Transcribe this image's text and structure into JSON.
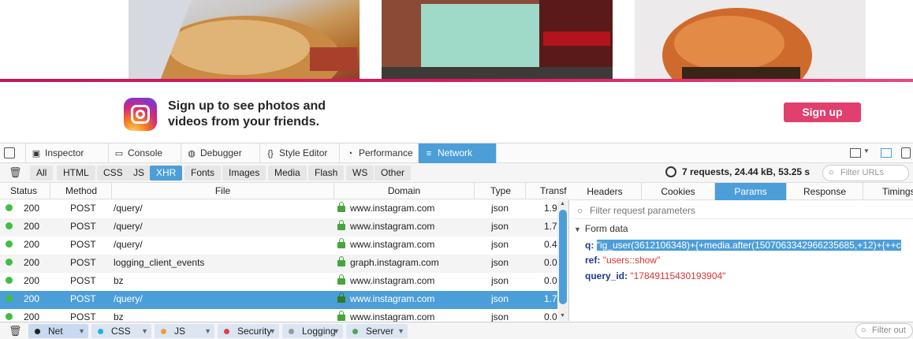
{
  "banner": {
    "text": "Sign up to see photos and videos from your friends.",
    "signup_label": "Sign up",
    "brand_color": "#e13f6e"
  },
  "devtools": {
    "tabs": [
      "Inspector",
      "Console",
      "Debugger",
      "Style Editor",
      "Performance",
      "Network"
    ],
    "active_tab": "Network",
    "filters": [
      "All",
      "HTML",
      "CSS",
      "JS",
      "XHR",
      "Fonts",
      "Images",
      "Media",
      "Flash",
      "WS",
      "Other"
    ],
    "active_filter": "XHR",
    "summary": "7 requests, 24.44 kB, 53.25 s",
    "filter_urls_placeholder": "Filter URLs",
    "columns": [
      "Status",
      "Method",
      "File",
      "Domain",
      "Type",
      "Transf"
    ],
    "requests": [
      {
        "status": "200",
        "method": "POST",
        "file": "/query/",
        "domain": "www.instagram.com",
        "type": "json",
        "transferred": "1.9"
      },
      {
        "status": "200",
        "method": "POST",
        "file": "/query/",
        "domain": "www.instagram.com",
        "type": "json",
        "transferred": "1.7"
      },
      {
        "status": "200",
        "method": "POST",
        "file": "/query/",
        "domain": "www.instagram.com",
        "type": "json",
        "transferred": "0.4"
      },
      {
        "status": "200",
        "method": "POST",
        "file": "logging_client_events",
        "domain": "graph.instagram.com",
        "type": "json",
        "transferred": "0.0"
      },
      {
        "status": "200",
        "method": "POST",
        "file": "bz",
        "domain": "www.instagram.com",
        "type": "json",
        "transferred": "0.0"
      },
      {
        "status": "200",
        "method": "POST",
        "file": "/query/",
        "domain": "www.instagram.com",
        "type": "json",
        "transferred": "1.7"
      },
      {
        "status": "200",
        "method": "POST",
        "file": "bz",
        "domain": "www.instagram.com",
        "type": "json",
        "transferred": "0.0"
      }
    ],
    "selected_row": 5,
    "details": {
      "tabs": [
        "Headers",
        "Cookies",
        "Params",
        "Response",
        "Timings"
      ],
      "active_tab": "Params",
      "filter_placeholder": "Filter request parameters",
      "section": "Form data",
      "params": [
        {
          "key": "q",
          "value": "\"ig_user(3612106348)+{+media.after(1507063342966235685,+12)+{++c"
        },
        {
          "key": "ref",
          "value": "\"users::show\""
        },
        {
          "key": "query_id",
          "value": "\"17849115430193904\""
        }
      ]
    },
    "console_filters": [
      {
        "label": "Net",
        "color": "#222222"
      },
      {
        "label": "CSS",
        "color": "#1eaee9"
      },
      {
        "label": "JS",
        "color": "#f39c33"
      },
      {
        "label": "Security",
        "color": "#e24040"
      },
      {
        "label": "Logging",
        "color": "#999999"
      },
      {
        "label": "Server",
        "color": "#58a05b"
      }
    ],
    "filter_output_placeholder": "Filter out"
  }
}
